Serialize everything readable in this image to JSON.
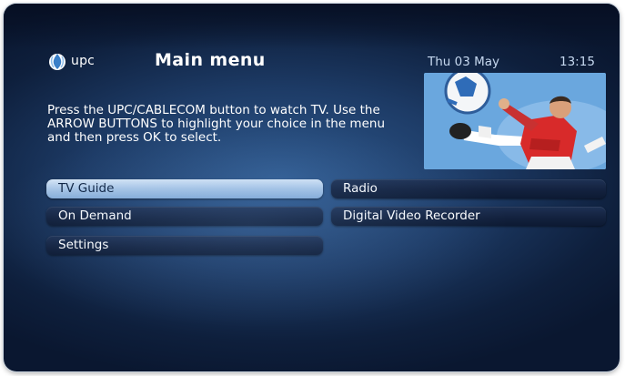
{
  "header": {
    "logo_text": "upc",
    "title": "Main menu",
    "date": "Thu 03 May",
    "time": "13:15"
  },
  "instructions": "Press the UPC/CABLECOM button to watch TV. Use the ARROW BUTTONS to highlight your choice in the menu and then press OK to select.",
  "promo": {
    "icon": "footballer-kicking-ball-image"
  },
  "menu": {
    "selected": "tv_guide",
    "items": {
      "tv_guide": "TV Guide",
      "radio": "Radio",
      "on_demand": "On Demand",
      "dvr": "Digital Video Recorder",
      "settings": "Settings"
    }
  },
  "colors": {
    "background": "#1d3b66",
    "selected_button": "#a9c6e6",
    "button": "#13223f",
    "date_text": "#c6d8ef"
  }
}
